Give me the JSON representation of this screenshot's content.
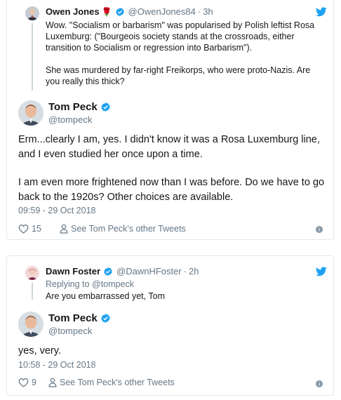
{
  "tweet1": {
    "quoted": {
      "name": "Owen Jones",
      "emoji": "🌹",
      "handle": "@OwenJones84",
      "time": "3h",
      "para1": "Wow. \"Socialism or barbarism\" was popularised by Polish leftist Rosa Luxemburg: (\"Bourgeois society stands at the crossroads, either transition to Socialism or regression into Barbarism\").",
      "para2": "She was murdered by far-right Freikorps, who were proto-Nazis. Are you really this thick?"
    },
    "reply": {
      "name": "Tom Peck",
      "handle": "@tompeck",
      "para1": "Erm...clearly I am, yes. I didn't know it was a Rosa Luxemburg line, and I even studied her once upon a time.",
      "para2": "I am even more frightened now than I was before. Do we have to go back to the 1920s? Other choices are available.",
      "timestamp": "09:59 - 29 Oct 2018",
      "likes": "15",
      "profile_link": "See Tom Peck's other Tweets"
    }
  },
  "tweet2": {
    "quoted": {
      "name": "Dawn Foster",
      "handle": "@DawnHFoster",
      "time": "2h",
      "replying_to": "Replying to @tompeck",
      "text": "Are you embarrassed yet, Tom"
    },
    "reply": {
      "name": "Tom Peck",
      "handle": "@tompeck",
      "text": "yes, very.",
      "timestamp": "10:58 - 29 Oct 2018",
      "likes": "9",
      "profile_link": "See Tom Peck's other Tweets"
    }
  },
  "colors": {
    "twitter_blue": "#1da1f2",
    "muted": "#657786",
    "border": "#e1e8ed"
  }
}
